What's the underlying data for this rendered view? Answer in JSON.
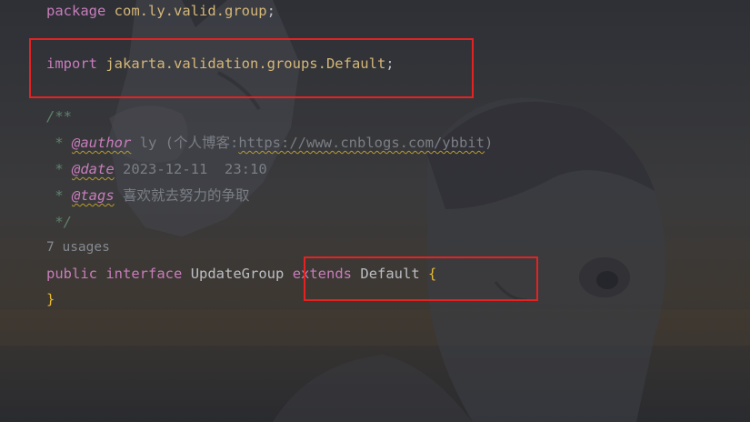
{
  "code": {
    "package_kw": "package",
    "package_name": "com.ly.valid.group",
    "package_semicolon": ";",
    "import_kw": "import",
    "import_name": "jakarta.validation.groups.Default",
    "import_semicolon": ";",
    "doc_open": "/**",
    "doc_star": " *",
    "doc_close": " */",
    "author_tag": "@author",
    "author_value": " ly (个人博客:",
    "author_link": "https://www.cnblogs.com/ybbit",
    "author_end": ")",
    "date_tag": "@date",
    "date_value": " 2023-12-11  23:10",
    "tags_tag": "@tags",
    "tags_value": " 喜欢就去努力的争取",
    "usages": "7 usages",
    "public_kw": "public",
    "interface_kw": "interface",
    "class_name": "UpdateGroup",
    "extends_kw": "extends",
    "extends_name": "Default",
    "open_brace": "{",
    "close_brace": "}"
  },
  "colors": {
    "highlight_box": "#e52222",
    "background": "#2b2d33"
  }
}
